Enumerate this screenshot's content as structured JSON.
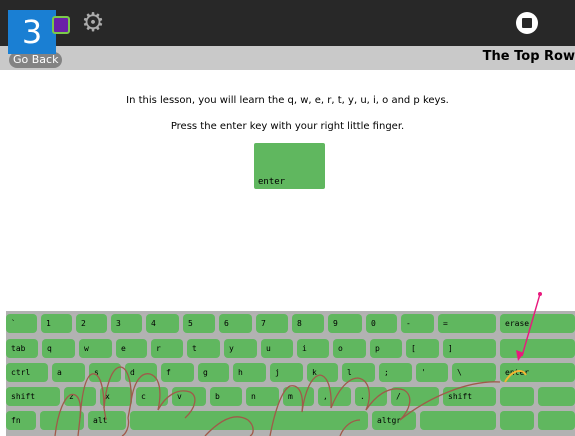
{
  "toolbar": {
    "step_number": "3",
    "activity_icon": "activity-icon",
    "settings_icon": "gear-icon",
    "stop_icon": "stop-icon"
  },
  "nav": {
    "go_back": "Go Back",
    "title": "The Top Row"
  },
  "lesson": {
    "intro": "In this lesson, you will learn the q, w, e, r, t, y, u, i, o and p keys.",
    "instruction": "Press the enter key with your right little finger.",
    "target_key": "enter"
  },
  "keyboard": {
    "rows": [
      [
        "`",
        "1",
        "2",
        "3",
        "4",
        "5",
        "6",
        "7",
        "8",
        "9",
        "0",
        "-",
        "=",
        "erase"
      ],
      [
        "tab",
        "q",
        "w",
        "e",
        "r",
        "t",
        "y",
        "u",
        "i",
        "o",
        "p",
        "[",
        "]",
        ""
      ],
      [
        "ctrl",
        "a",
        "s",
        "d",
        "f",
        "g",
        "h",
        "j",
        "k",
        "l",
        ";",
        "'",
        "\\",
        "enter"
      ],
      [
        "shift",
        "z",
        "x",
        "c",
        "v",
        "b",
        "n",
        "m",
        ",",
        ".",
        "/",
        "shift",
        "",
        ""
      ],
      [
        "fn",
        "",
        "alt",
        "",
        "altgr",
        "",
        "",
        ""
      ]
    ]
  },
  "colors": {
    "key": "#60b75f",
    "keyboard_bg": "#b2b2b2",
    "step_badge": "#1a7fd3",
    "arrow": "#e8197d",
    "finger_highlight": "#f2b632",
    "hand_outline": "#a05a4a"
  }
}
